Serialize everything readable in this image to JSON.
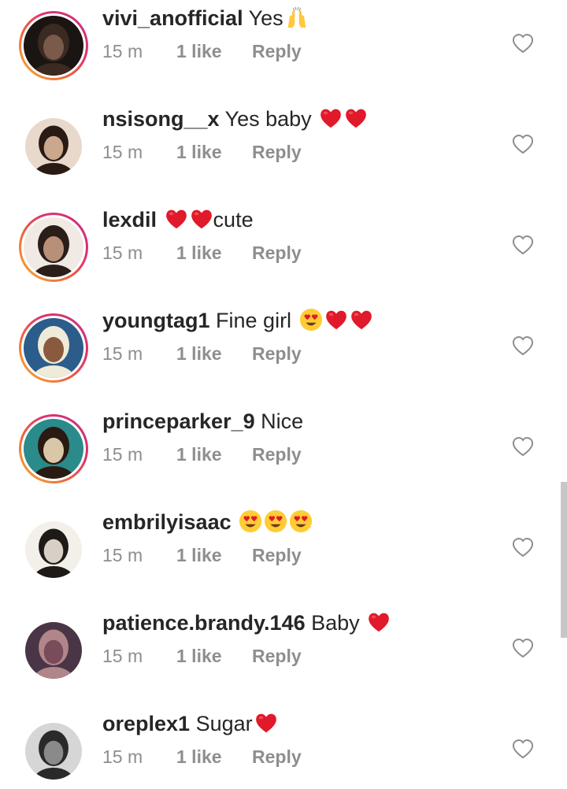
{
  "comments": [
    {
      "username": "vivi_anofficial",
      "text": "Yes",
      "emojis": [
        "raising-hands"
      ],
      "time": "15 m",
      "likes": "1 like",
      "reply": "Reply",
      "story_ring": true,
      "avatar_colors": [
        "#1a1512",
        "#3a2a22",
        "#7a5a4a"
      ]
    },
    {
      "username": "nsisong__x",
      "text": "Yes baby ",
      "emojis": [
        "red-heart",
        "red-heart"
      ],
      "time": "15 m",
      "likes": "1 like",
      "reply": "Reply",
      "story_ring": false,
      "avatar_colors": [
        "#e9d8cc",
        "#2a1a14",
        "#c9a88e"
      ]
    },
    {
      "username": "lexdil",
      "text": "cute",
      "emojis_before": [
        "red-heart",
        "red-heart"
      ],
      "time": "15 m",
      "likes": "1 like",
      "reply": "Reply",
      "story_ring": true,
      "avatar_colors": [
        "#f1e9e3",
        "#2b1d18",
        "#b8907a"
      ]
    },
    {
      "username": "youngtag1",
      "text": "Fine girl ",
      "emojis": [
        "heart-eyes",
        "red-heart",
        "red-heart"
      ],
      "time": "15 m",
      "likes": "1 like",
      "reply": "Reply",
      "story_ring": true,
      "avatar_colors": [
        "#2c5d8a",
        "#f0ead8",
        "#8a5a3e"
      ]
    },
    {
      "username": "princeparker_9",
      "text": "Nice",
      "emojis": [],
      "time": "15 m",
      "likes": "1 like",
      "reply": "Reply",
      "story_ring": true,
      "avatar_colors": [
        "#2b8a8a",
        "#2a1a12",
        "#d9c7a8"
      ]
    },
    {
      "username": "embrilyisaac",
      "text": "",
      "emojis": [
        "heart-eyes",
        "heart-eyes",
        "heart-eyes"
      ],
      "time": "15 m",
      "likes": "1 like",
      "reply": "Reply",
      "story_ring": false,
      "avatar_colors": [
        "#f3efe9",
        "#1e1a18",
        "#d8d0c6"
      ]
    },
    {
      "username": "patience.brandy.146",
      "text": "Baby ",
      "emojis": [
        "red-heart"
      ],
      "time": "15 m",
      "likes": "1 like",
      "reply": "Reply",
      "story_ring": false,
      "avatar_colors": [
        "#4a3546",
        "#b0868a",
        "#7a4b5b"
      ]
    },
    {
      "username": "oreplex1",
      "text": "Sugar",
      "emojis": [
        "red-heart"
      ],
      "time": "15 m",
      "likes": "1 like",
      "reply": "Reply",
      "story_ring": false,
      "avatar_colors": [
        "#d6d6d6",
        "#2a2a2a",
        "#8a8a8a"
      ]
    }
  ],
  "colors": {
    "text_primary": "#262626",
    "text_secondary": "#8e8e8e",
    "heart_red": "#e0192b",
    "icon_gray": "#8e8e8e",
    "story_gradient": [
      "#f9b233",
      "#e1306c",
      "#c13584"
    ]
  }
}
